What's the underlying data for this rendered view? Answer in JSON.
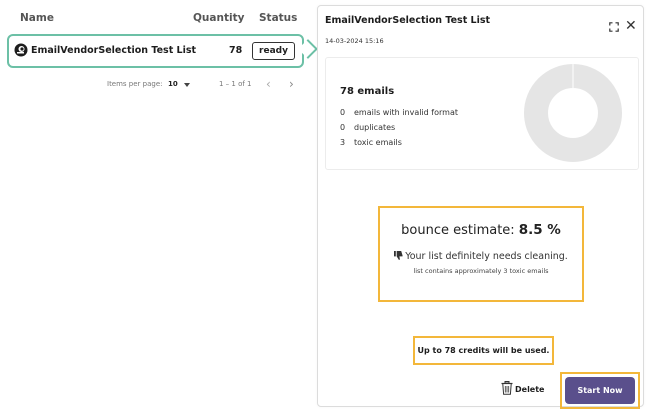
{
  "list": {
    "headers": {
      "name": "Name",
      "quantity": "Quantity",
      "status": "Status"
    },
    "rows": [
      {
        "name": "EmailVendorSelection Test List",
        "quantity": "78",
        "status": "ready"
      }
    ],
    "pagination": {
      "items_per_page_label": "Items per page:",
      "items_per_page_value": "10",
      "range": "1 – 1 of 1",
      "prev_icon": "chevron-left-icon",
      "next_icon": "chevron-right-icon"
    }
  },
  "detail": {
    "title": "EmailVendorSelection Test List",
    "date": "14-03-2024 15:16",
    "stats": {
      "total": "78 emails",
      "rows": [
        {
          "count": "0",
          "label": "emails with invalid format"
        },
        {
          "count": "0",
          "label": "duplicates"
        },
        {
          "count": "3",
          "label": "toxic emails"
        }
      ]
    },
    "bounce": {
      "label": "bounce estimate:",
      "value": "8.5 %",
      "advice": "Your list definitely needs cleaning.",
      "sub": "list contains approximately 3 toxic emails"
    },
    "credits_text": "Up to 78 credits will be used.",
    "delete_label": "Delete",
    "start_label": "Start Now"
  },
  "colors": {
    "row_border": "#6cc0a6",
    "highlight_border": "#f3b73a",
    "primary_button": "#5a4f8c",
    "donut": "#e5e5e5"
  }
}
